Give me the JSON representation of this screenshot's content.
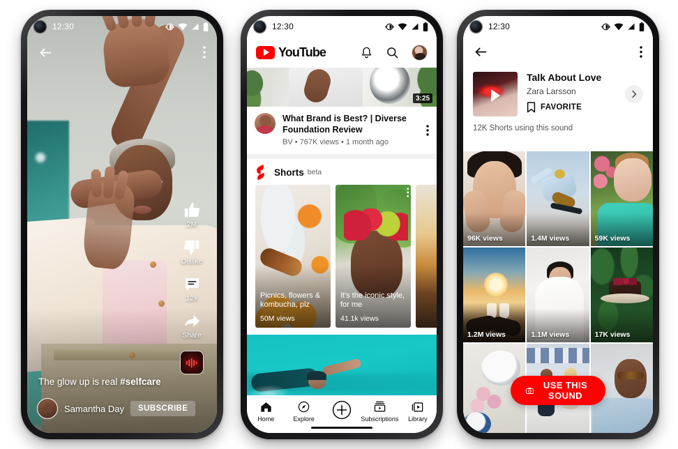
{
  "phones": {
    "left": {
      "status": {
        "time": "12:30",
        "icons": [
          "vibrate-icon",
          "wifi-icon",
          "signal-icon",
          "battery-icon"
        ]
      },
      "topbar": {
        "back": "back-arrow-icon",
        "more": "more-vertical-icon"
      },
      "rail": [
        {
          "icon": "thumbs-up-icon",
          "label": "2M"
        },
        {
          "icon": "thumbs-down-icon",
          "label": "Dislike"
        },
        {
          "icon": "comment-icon",
          "label": "12k"
        },
        {
          "icon": "share-icon",
          "label": "Share"
        }
      ],
      "sound_disc": "sound-waveform-icon",
      "caption": {
        "text": "The glow up is real ",
        "hashtag": "#selfcare"
      },
      "channel": {
        "name": "Samantha Day",
        "subscribe": "SUBSCRIBE"
      }
    },
    "mid": {
      "status": {
        "time": "12:30"
      },
      "header": {
        "logo_word": "YouTube",
        "bell": "bell-icon",
        "search": "search-icon",
        "avatar": "account-avatar"
      },
      "video": {
        "duration": "3:25",
        "title": "What Brand is Best? | Diverse Foundation Review",
        "meta": "BV • 767K views • 1 month ago"
      },
      "shelf": {
        "title": "Shorts",
        "badge": "beta",
        "cards": [
          {
            "title": "Picnics, flowers & kombucha, plz",
            "views": "50M views"
          },
          {
            "title": "It's the iconic style, for me",
            "views": "41.1k views"
          },
          {
            "title": "",
            "views": ""
          }
        ]
      },
      "nav": [
        {
          "icon": "home-icon",
          "label": "Home"
        },
        {
          "icon": "compass-icon",
          "label": "Explore"
        },
        {
          "icon": "plus-circle-icon",
          "label": ""
        },
        {
          "icon": "subscriptions-icon",
          "label": "Subscriptions"
        },
        {
          "icon": "library-icon",
          "label": "Library"
        }
      ]
    },
    "right": {
      "status": {
        "time": "12:30"
      },
      "topbar": {
        "back": "back-arrow-icon",
        "more": "more-vertical-icon"
      },
      "sound": {
        "name": "Talk About Love",
        "artist": "Zara Larsson",
        "favorite": "FAVORITE",
        "favorite_icon": "bookmark-icon",
        "chevron": "chevron-right-icon",
        "using": "12K Shorts using this sound"
      },
      "grid": [
        {
          "views": "96K views",
          "art": "g1"
        },
        {
          "views": "1.4M views",
          "art": "g2"
        },
        {
          "views": "59K views",
          "art": "g3"
        },
        {
          "views": "1.2M views",
          "art": "g4"
        },
        {
          "views": "1.1M views",
          "art": "g5"
        },
        {
          "views": "17K views",
          "art": "g6"
        },
        {
          "views": "",
          "art": "g7"
        },
        {
          "views": "",
          "art": "g8"
        },
        {
          "views": "",
          "art": "g9"
        }
      ],
      "cta": {
        "label": "USE THIS SOUND",
        "icon": "camera-icon"
      }
    }
  },
  "colors": {
    "brand_red": "#FF0000",
    "text_primary": "#0b0b0b",
    "text_secondary": "#616161",
    "divider": "#f1f1f1"
  }
}
